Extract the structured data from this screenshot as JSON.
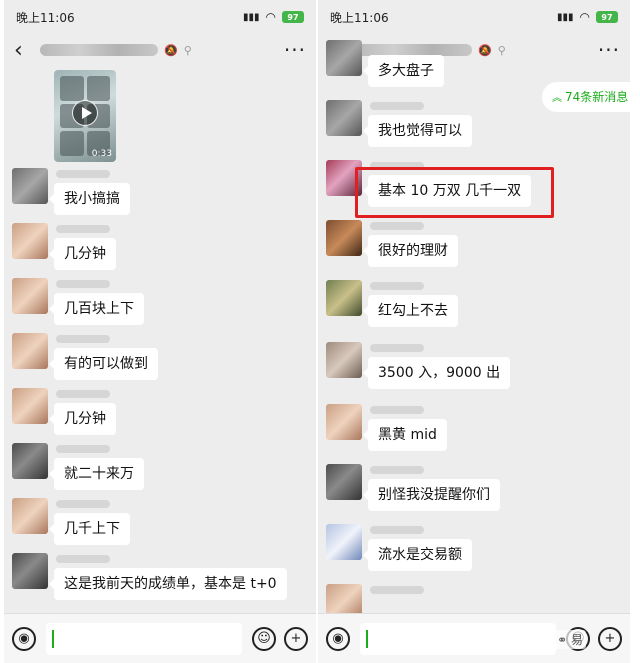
{
  "status_bar": {
    "time": "晚上11:06",
    "battery": "97"
  },
  "left_panel": {
    "video": {
      "duration": "0:33"
    },
    "messages": [
      {
        "text": "我小搞搞"
      },
      {
        "text": "几分钟"
      },
      {
        "text": "几百块上下"
      },
      {
        "text": "有的可以做到"
      },
      {
        "text": "几分钟"
      },
      {
        "text": "就二十来万"
      },
      {
        "text": "几千上下"
      },
      {
        "text": "这是我前天的成绩单，基本是 t+0"
      }
    ]
  },
  "right_panel": {
    "new_messages_pill": "74条新消息",
    "messages": [
      {
        "text": "多大盘子"
      },
      {
        "text": "我也觉得可以"
      },
      {
        "text": "基本 10 万双   几千一双"
      },
      {
        "text": "很好的理财"
      },
      {
        "text": "红勾上不去"
      },
      {
        "text": "3500 入，9000 出"
      },
      {
        "text": "黑黄 mid"
      },
      {
        "text": "别怪我没提醒你们"
      },
      {
        "text": "流水是交易额"
      }
    ]
  },
  "watermark": "易",
  "colors": {
    "accent_green": "#1aad19",
    "highlight_red": "#e02020",
    "chat_bg": "#ededed"
  }
}
